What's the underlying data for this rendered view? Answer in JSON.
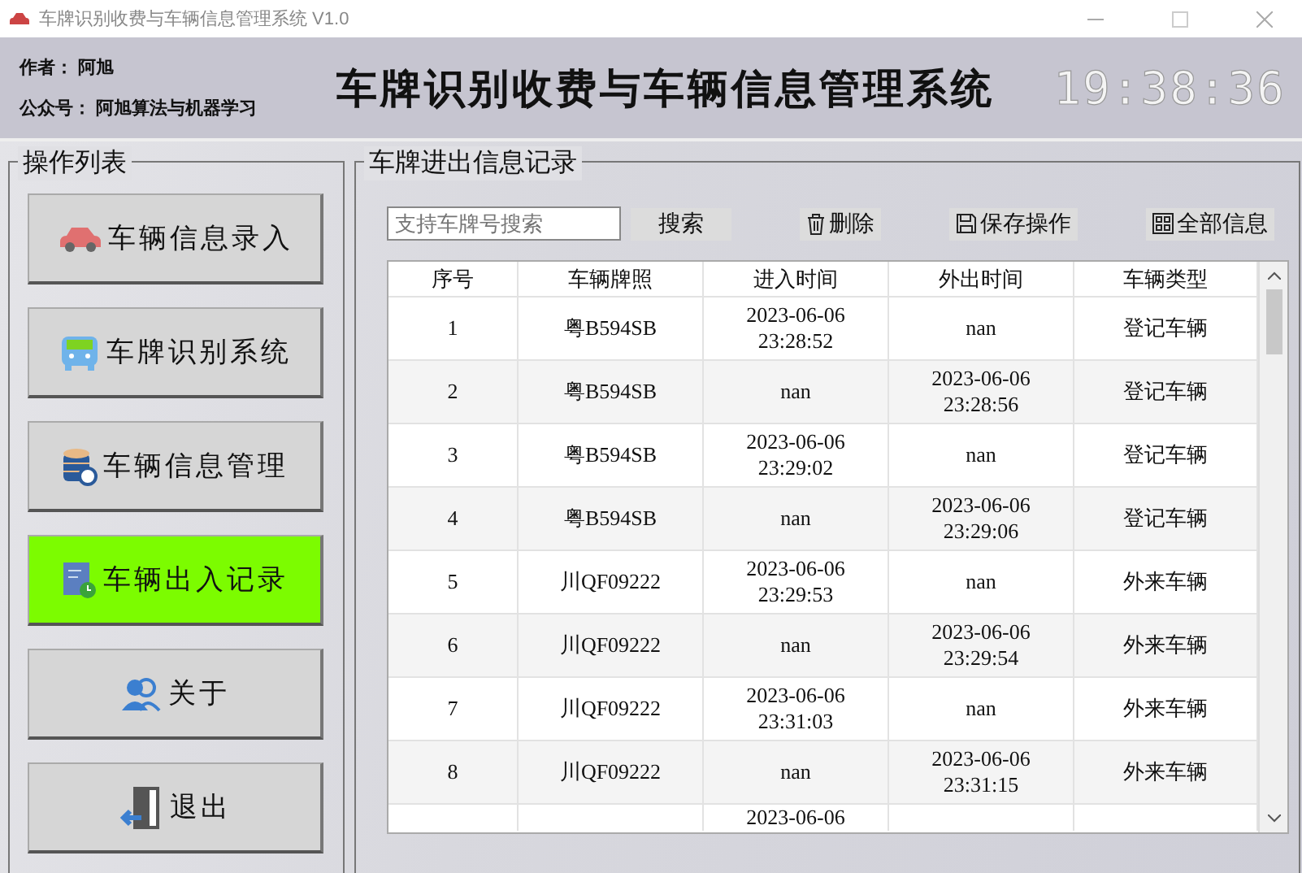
{
  "window": {
    "title": "车牌识别收费与车辆信息管理系统 V1.0"
  },
  "header": {
    "author": "作者： 阿旭",
    "account": "公众号： 阿旭算法与机器学习",
    "title": "车牌识别收费与车辆信息管理系统",
    "clock": "19:38:36"
  },
  "sidebar": {
    "title": "操作列表",
    "items": [
      {
        "label": "车辆信息录入",
        "selected": false
      },
      {
        "label": "车牌识别系统",
        "selected": false
      },
      {
        "label": "车辆信息管理",
        "selected": false
      },
      {
        "label": "车辆出入记录",
        "selected": true
      },
      {
        "label": "关于",
        "selected": false
      },
      {
        "label": "退出",
        "selected": false
      }
    ]
  },
  "records": {
    "title": "车牌进出信息记录",
    "search": {
      "placeholder": "支持车牌号搜索"
    },
    "toolbar": [
      "搜索",
      "删除",
      "保存操作",
      "全部信息"
    ],
    "table": {
      "columns": [
        "序号",
        "车辆牌照",
        "进入时间",
        "外出时间",
        "车辆类型"
      ],
      "rows": [
        {
          "index": "1",
          "plate": "粤B594SB",
          "entry_time": "2023-06-06\n23:28:52",
          "exit_time": "nan",
          "type": "登记车辆"
        },
        {
          "index": "2",
          "plate": "粤B594SB",
          "entry_time": "nan",
          "exit_time": "2023-06-06\n23:28:56",
          "type": "登记车辆"
        },
        {
          "index": "3",
          "plate": "粤B594SB",
          "entry_time": "2023-06-06\n23:29:02",
          "exit_time": "nan",
          "type": "登记车辆"
        },
        {
          "index": "4",
          "plate": "粤B594SB",
          "entry_time": "nan",
          "exit_time": "2023-06-06\n23:29:06",
          "type": "登记车辆"
        },
        {
          "index": "5",
          "plate": "川QF09222",
          "entry_time": "2023-06-06\n23:29:53",
          "exit_time": "nan",
          "type": "外来车辆"
        },
        {
          "index": "6",
          "plate": "川QF09222",
          "entry_time": "nan",
          "exit_time": "2023-06-06\n23:29:54",
          "type": "外来车辆"
        },
        {
          "index": "7",
          "plate": "川QF09222",
          "entry_time": "2023-06-06\n23:31:03",
          "exit_time": "nan",
          "type": "外来车辆"
        },
        {
          "index": "8",
          "plate": "川QF09222",
          "entry_time": "nan",
          "exit_time": "2023-06-06\n23:31:15",
          "type": "外来车辆"
        },
        {
          "entry_time": "2023-06-06"
        }
      ]
    }
  }
}
